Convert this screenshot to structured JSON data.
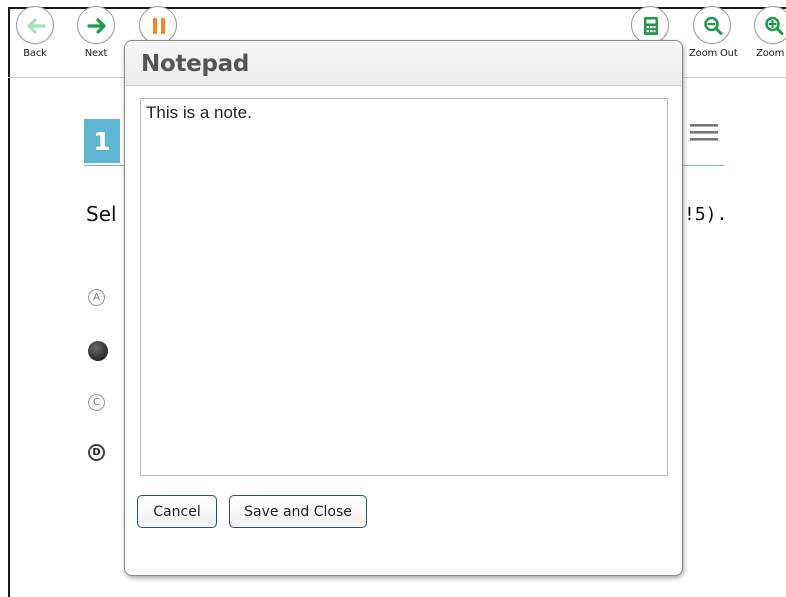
{
  "toolbar": {
    "back": {
      "label": "Back",
      "icon": "arrow-left-icon"
    },
    "next": {
      "label": "Next",
      "icon": "arrow-right-icon"
    },
    "pause": {
      "icon": "pause-icon"
    },
    "calculator": {
      "icon": "calculator-icon"
    },
    "zoom_out": {
      "label": "Zoom Out",
      "icon": "zoom-out-icon"
    },
    "zoom_in": {
      "label": "Zoom I",
      "icon": "zoom-in-icon"
    }
  },
  "question": {
    "number": "1",
    "text_left": "Sel",
    "text_right": "!5).",
    "options": [
      {
        "letter": "A",
        "state": "unselected"
      },
      {
        "letter": "",
        "state": "selected"
      },
      {
        "letter": "C",
        "state": "unselected"
      },
      {
        "letter": "D",
        "state": "struck"
      }
    ]
  },
  "notepad": {
    "title": "Notepad",
    "note_text": "This is a note.",
    "cancel_label": "Cancel",
    "save_label": "Save and Close"
  },
  "colors": {
    "back_arrow": "#a8dfb8",
    "next_arrow": "#1f9a48",
    "pause": "#f08a1c",
    "calculator": "#1f9a48",
    "zoom": "#1f9a48",
    "question_number_bg": "#5fb5d4",
    "button_border": "#2f4f6a"
  }
}
